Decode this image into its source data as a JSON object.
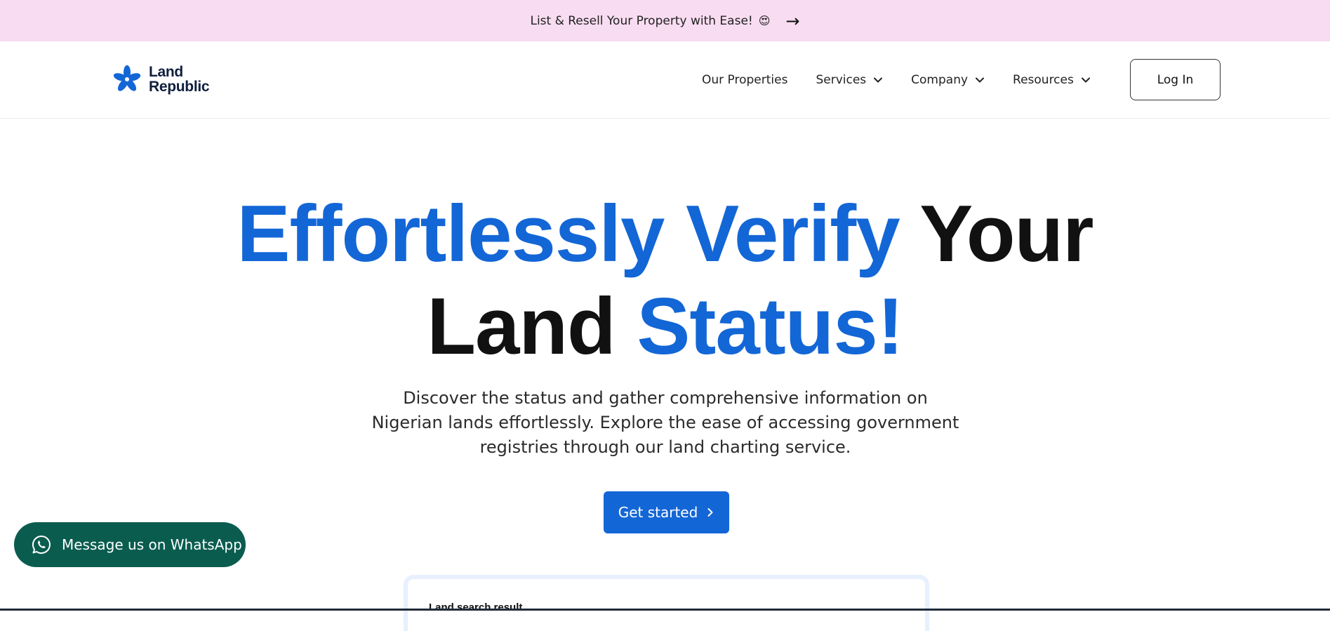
{
  "announcement": {
    "text": "List & Resell Your Property with Ease!",
    "emoji": "😍",
    "arrow_icon": "arrow-right-icon"
  },
  "brand": {
    "name_line1": "Land",
    "name_line2": "Republic",
    "color": "#1366d6"
  },
  "nav": {
    "items": [
      {
        "label": "Our Properties",
        "has_dropdown": false
      },
      {
        "label": "Services",
        "has_dropdown": true
      },
      {
        "label": "Company",
        "has_dropdown": true
      },
      {
        "label": "Resources",
        "has_dropdown": true
      }
    ],
    "login_label": "Log In"
  },
  "hero": {
    "title_part1": "Effortlessly Verify",
    "title_part2": "Your",
    "title_part3": "Land",
    "title_part4": "Status!",
    "subtitle": "Discover the status and gather comprehensive information on Nigerian lands effortlessly. Explore the ease of accessing government registries through our land charting service.",
    "cta_label": "Get started",
    "accent_color": "#1366d6"
  },
  "whatsapp": {
    "label": "Message us on WhatsApp",
    "color": "#0a5c4f"
  },
  "preview": {
    "title": "Land search result"
  }
}
